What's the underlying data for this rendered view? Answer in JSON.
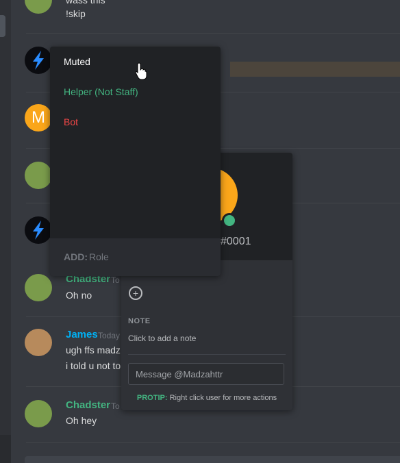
{
  "colors": {
    "green": "#43b581",
    "blue": "#00b0f4",
    "red": "#f04747",
    "orange": "#faa61a"
  },
  "messages": {
    "top": {
      "line1": "wass this",
      "line2": "!skip"
    },
    "chadster1": {
      "name": "Chadster",
      "time": "To",
      "text": "Oh no"
    },
    "james": {
      "name": "James",
      "time": "Today",
      "line1": "ugh ffs madz",
      "line2": "i told u not to"
    },
    "chadster2": {
      "name": "Chadster",
      "time": "To",
      "text": "Oh hey"
    },
    "m_avatar_letter": "M"
  },
  "roles_popup": {
    "roles": [
      "Muted",
      "Helper (Not Staff)",
      "Bot"
    ],
    "add_label": "ADD:",
    "add_placeholder": "Role"
  },
  "profile": {
    "discriminator": "#0001",
    "add_role_icon": "+",
    "note_label": "NOTE",
    "note_placeholder": "Click to add a note",
    "message_placeholder": "Message @Madzahttr",
    "protip_label": "PROTIP:",
    "protip_text": " Right click user for more actions"
  },
  "icons": [
    "lightning-avatar",
    "link-avatar",
    "hamster-avatar",
    "hand-cursor-icon",
    "plus-icon"
  ]
}
